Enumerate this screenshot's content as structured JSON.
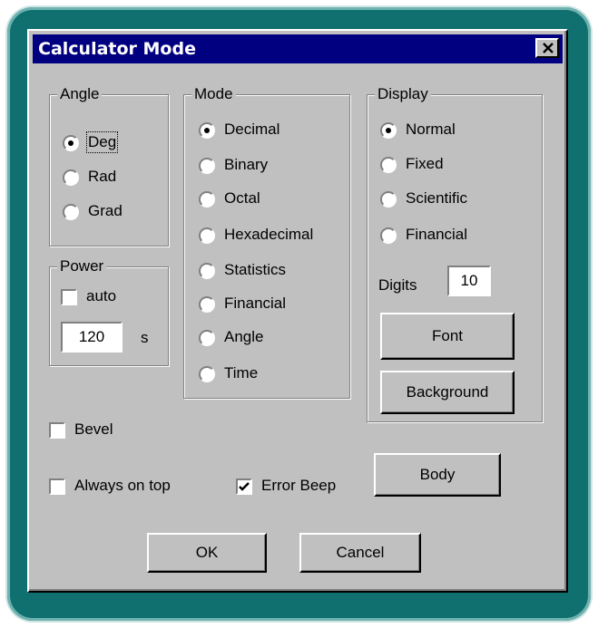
{
  "window": {
    "title": "Calculator Mode",
    "close_glyph": "✕"
  },
  "angle": {
    "legend": "Angle",
    "options": [
      {
        "label": "Deg",
        "selected": true
      },
      {
        "label": "Rad",
        "selected": false
      },
      {
        "label": "Grad",
        "selected": false
      }
    ]
  },
  "power": {
    "legend": "Power",
    "auto_label": "auto",
    "auto_checked": false,
    "timeout_value": "120",
    "unit": "s"
  },
  "mode": {
    "legend": "Mode",
    "options": [
      {
        "label": "Decimal",
        "selected": true
      },
      {
        "label": "Binary",
        "selected": false
      },
      {
        "label": "Octal",
        "selected": false
      },
      {
        "label": "Hexadecimal",
        "selected": false
      },
      {
        "label": "Statistics",
        "selected": false
      },
      {
        "label": "Financial",
        "selected": false
      },
      {
        "label": "Angle",
        "selected": false
      },
      {
        "label": "Time",
        "selected": false
      }
    ]
  },
  "display": {
    "legend": "Display",
    "options": [
      {
        "label": "Normal",
        "selected": true
      },
      {
        "label": "Fixed",
        "selected": false
      },
      {
        "label": "Scientific",
        "selected": false
      },
      {
        "label": "Financial",
        "selected": false
      }
    ],
    "digits_label": "Digits",
    "digits_value": "10",
    "font_button": "Font",
    "background_button": "Background"
  },
  "options": {
    "bevel": {
      "label": "Bevel",
      "checked": false
    },
    "always_on_top": {
      "label": "Always on top",
      "checked": false
    },
    "error_beep": {
      "label": "Error Beep",
      "checked": true
    },
    "body_button": "Body"
  },
  "buttons": {
    "ok": "OK",
    "cancel": "Cancel"
  },
  "colors": {
    "titlebar": "#000080",
    "dialog": "#c0c0c0",
    "frame": "#10706f"
  }
}
